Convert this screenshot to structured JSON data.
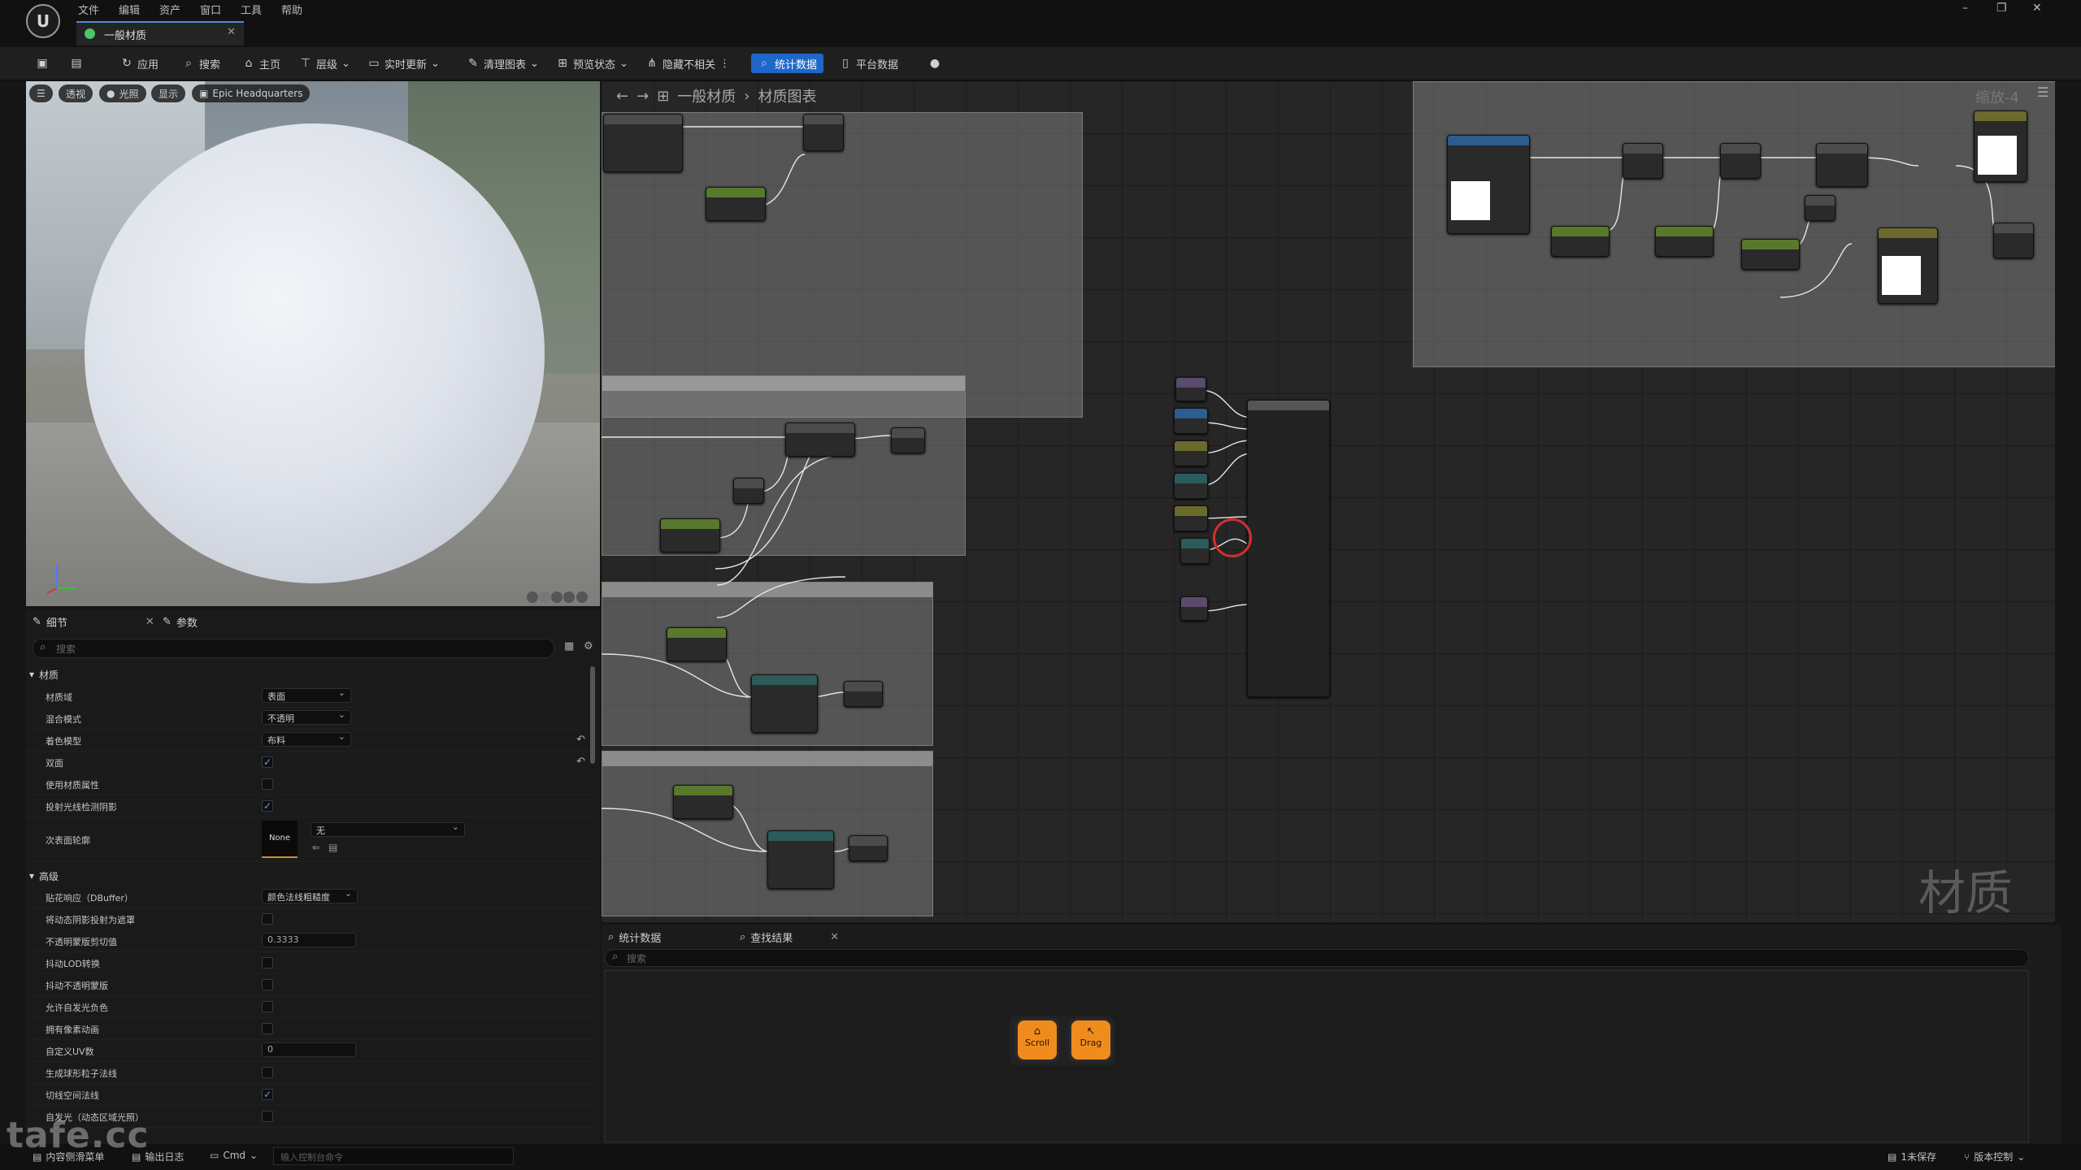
{
  "app": {
    "logo_text": "U",
    "menu": [
      "文件",
      "编辑",
      "资产",
      "窗口",
      "工具",
      "帮助"
    ],
    "tab_title": "一般材质",
    "window_controls": [
      "–",
      "❐",
      "✕"
    ]
  },
  "toolbar": {
    "apply": "应用",
    "search": "搜索",
    "home": "主页",
    "hierarchy": "层级",
    "live_update": "实时更新",
    "clean_graph": "清理图表",
    "preview_state": "预览状态",
    "hide_unrelated": "隐藏不相关",
    "stats": "统计数据",
    "platform_stats": "平台数据"
  },
  "viewport": {
    "buttons": [
      "透视",
      "光照",
      "显示"
    ],
    "location": "Epic Headquarters"
  },
  "details": {
    "tab_details": "细节",
    "tab_params": "参数",
    "search_placeholder": "搜索",
    "section_material": "材质",
    "section_advanced": "高级",
    "rows_material": [
      {
        "label": "材质域",
        "type": "dropdown",
        "value": "表面"
      },
      {
        "label": "混合模式",
        "type": "dropdown",
        "value": "不透明"
      },
      {
        "label": "着色模型",
        "type": "dropdown",
        "value": "布料"
      },
      {
        "label": "双面",
        "type": "checkbox",
        "checked": true
      },
      {
        "label": "使用材质属性",
        "type": "checkbox",
        "checked": false
      },
      {
        "label": "投射光线检测阴影",
        "type": "checkbox",
        "checked": true
      }
    ],
    "subsurface_label": "次表面轮廓",
    "subsurface_thumb": "None",
    "subsurface_value": "无",
    "rows_advanced": [
      {
        "label": "贴花响应（DBuffer）",
        "type": "dropdown",
        "value": "颜色法线粗糙度"
      },
      {
        "label": "将动态阴影投射为遮罩",
        "type": "checkbox",
        "checked": false
      },
      {
        "label": "不透明蒙版剪切值",
        "type": "number",
        "value": "0.3333"
      },
      {
        "label": "抖动LOD转换",
        "type": "checkbox",
        "checked": false
      },
      {
        "label": "抖动不透明蒙版",
        "type": "checkbox",
        "checked": false
      },
      {
        "label": "允许自发光负色",
        "type": "checkbox",
        "checked": false
      },
      {
        "label": "拥有像素动画",
        "type": "checkbox",
        "checked": false
      },
      {
        "label": "自定义UV数",
        "type": "number",
        "value": "0"
      },
      {
        "label": "生成球形粒子法线",
        "type": "checkbox",
        "checked": false
      },
      {
        "label": "切线空间法线",
        "type": "checkbox",
        "checked": true
      },
      {
        "label": "自发光（动态区域光照）",
        "type": "checkbox",
        "checked": false
      }
    ]
  },
  "graph": {
    "breadcrumb": [
      "一般材质",
      "材质图表"
    ],
    "zoom": "缩放-4",
    "watermark": "材质"
  },
  "bottom": {
    "tab_stats": "统计数据",
    "tab_find": "查找结果",
    "search_placeholder": "搜索",
    "keys": [
      "Scroll",
      "Drag"
    ]
  },
  "status": {
    "content_drawer": "内容侧滑菜单",
    "output_log": "输出日志",
    "cmd": "Cmd",
    "cmd_placeholder": "输入控制台命令",
    "unsaved": "1未保存",
    "source_control": "版本控制"
  },
  "watermark_logo": "tafe.cc"
}
